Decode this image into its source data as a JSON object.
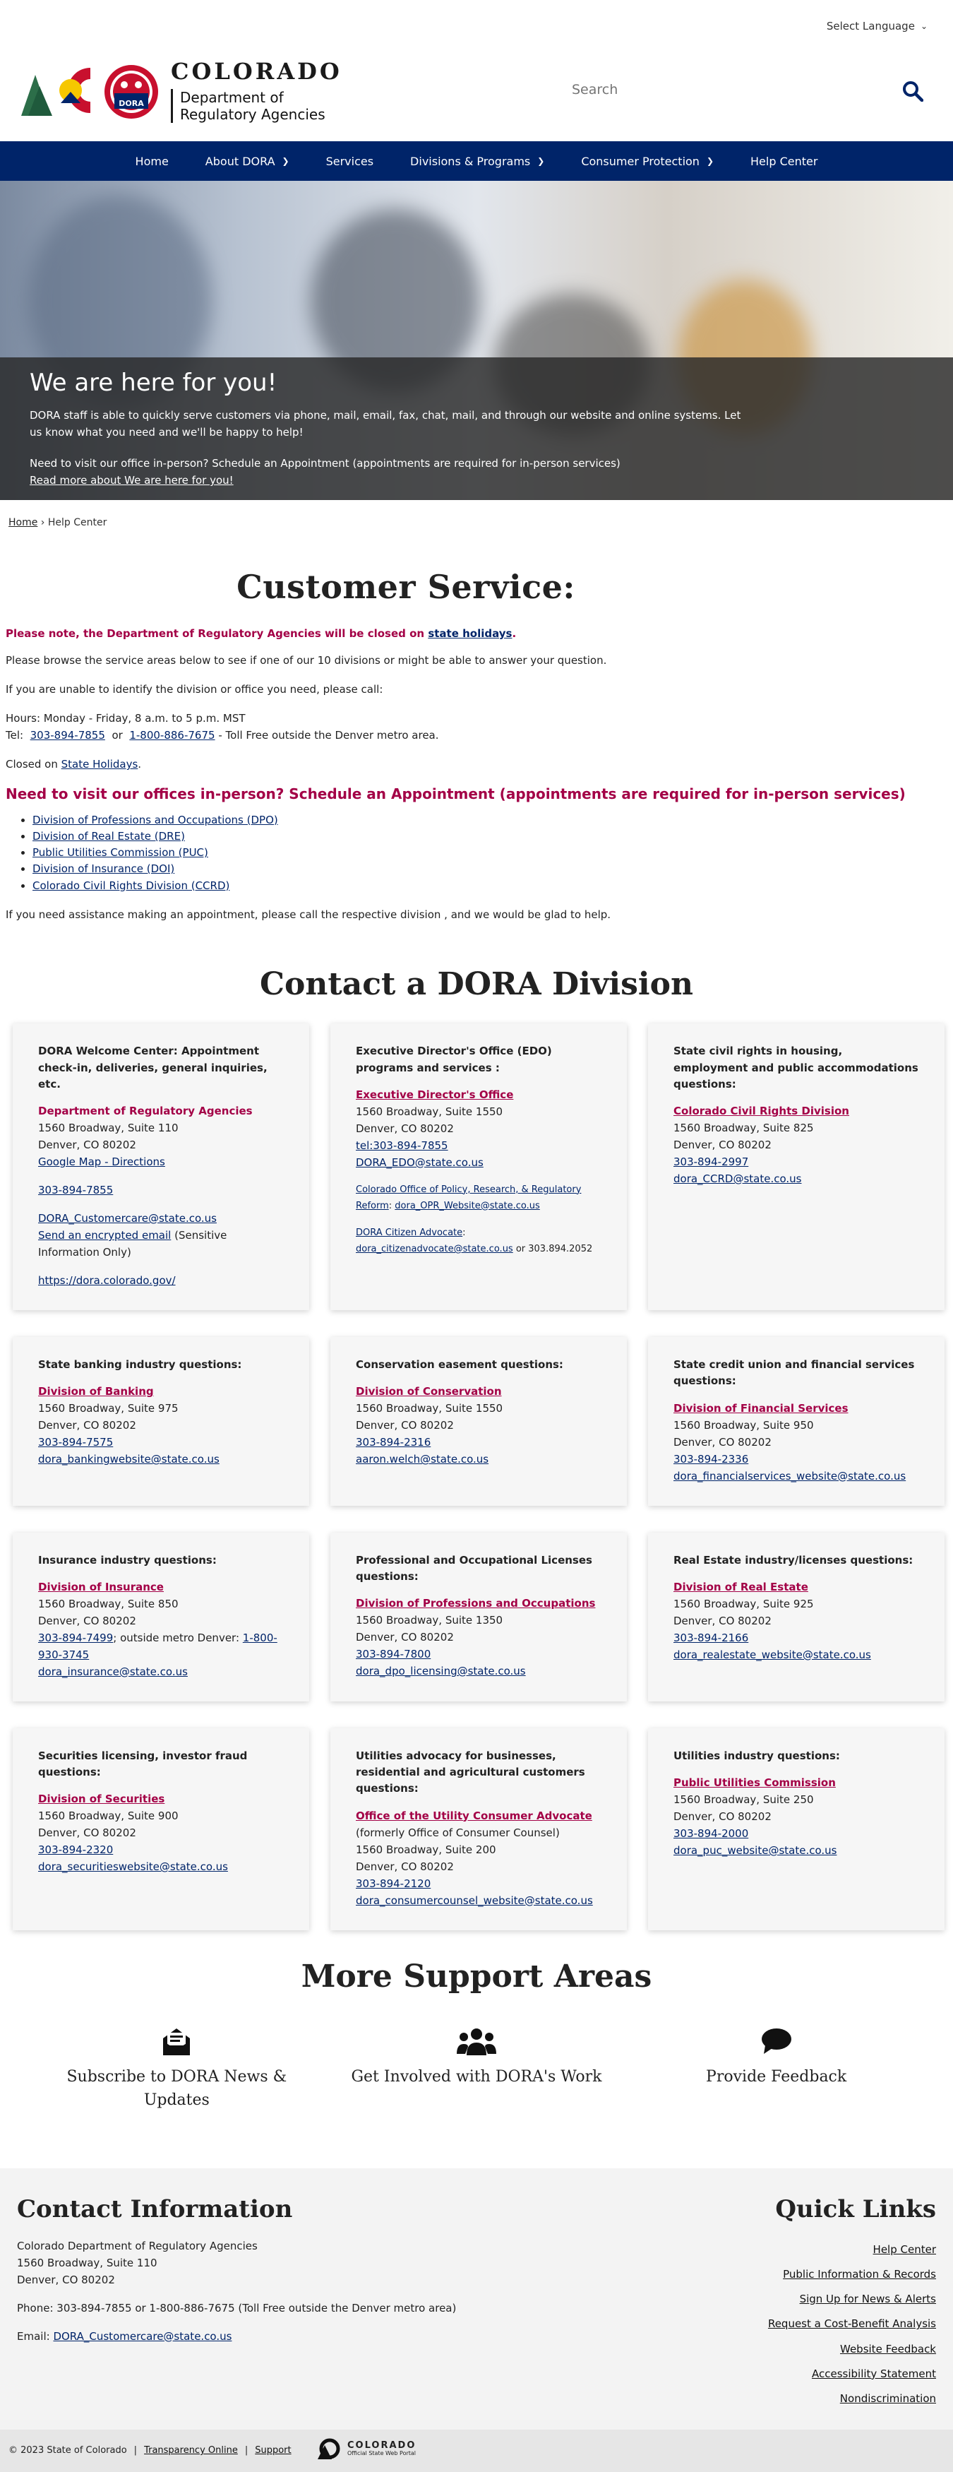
{
  "header": {
    "language_label": "Select Language",
    "logo_state": "COLORADO",
    "logo_agency_line1": "Department of",
    "logo_agency_line2": "Regulatory Agencies",
    "logo_badge": "DORA",
    "search_placeholder": "Search"
  },
  "nav": {
    "items": [
      {
        "label": "Home"
      },
      {
        "label": "About DORA"
      },
      {
        "label": "Services"
      },
      {
        "label": "Divisions & Programs"
      },
      {
        "label": "Consumer Protection"
      },
      {
        "label": "Help Center"
      }
    ]
  },
  "hero": {
    "title": "We are here for you!",
    "text1": "DORA staff is able to quickly serve customers via phone, mail, email, fax, chat, mail, and through our website and online systems. Let us know what you need and we'll be happy to help!",
    "text2": "Need to visit our office in-person? Schedule an Appointment (appointments are required for in-person services)",
    "link": "Read more about We are here for you!"
  },
  "breadcrumb": {
    "home": "Home",
    "current": "Help Center"
  },
  "customer_service": {
    "title": "Customer Service:",
    "notice_text": "Please note, the Department of Regulatory Agencies will be closed on ",
    "notice_link": "state holidays",
    "browse": "Please browse the service areas below to see if one of our 10 divisions or might be able to answer your question.",
    "unable": "If you are unable to identify the division or office you need, please call:",
    "hours": "Hours:  Monday - Friday, 8 a.m. to 5 p.m. MST",
    "tel_label": "Tel:",
    "tel1": "303-894-7855",
    "tel_or": "or",
    "tel2": "1-800-886-7675",
    "tel_suffix": "- Toll Free outside the Denver metro area.",
    "closed_label": "Closed on",
    "closed_link": "State Holidays",
    "visit_heading": "Need to visit our offices in-person? Schedule an Appointment (appointments are required for in-person services)",
    "divisions": [
      "Division of Professions and Occupations (DPO)",
      "Division of Real Estate (DRE)",
      "Public Utilities Commission (PUC)",
      "Division of Insurance (DOI)",
      "Colorado Civil Rights Division (CCRD)"
    ],
    "assist": "If you need assistance making an appointment, please call the respective division , and we would be glad to help."
  },
  "contact_title": "Contact a DORA Division",
  "cards": {
    "welcome": {
      "q": "DORA Welcome Center: Appointment check-in, deliveries, general inquiries, etc.",
      "name": "Department of Regulatory Agencies",
      "addr1": "1560 Broadway, Suite 110",
      "addr2": "Denver, CO  80202",
      "map": "Google Map - Directions",
      "phone": "303-894-7855",
      "email": "DORA_Customercare@state.co.us",
      "encrypted": "Send an encrypted email",
      "encrypted_note": " (Sensitive Information Only)",
      "web": "https://dora.colorado.gov/"
    },
    "edo": {
      "q": "Executive Director's Office (EDO) programs and services :",
      "name": "Executive Director's Office",
      "addr1": "1560 Broadway, Suite 1550",
      "addr2": "Denver, CO 80202",
      "tel": "tel:303-894-7855",
      "email": "DORA_EDO@state.co.us",
      "copr": "Colorado Office of Policy, Research, & Regulatory Reform",
      "copr_sep": ":  ",
      "copr_email": "dora_OPR_Website@state.co.us",
      "advocate": "DORA Citizen Advocate",
      "advocate_sep": ":",
      "advocate_email": "dora_citizenadvocate@state.co.us",
      "advocate_phone": " or 303.894.2052"
    },
    "ccrd": {
      "q": "State civil rights in housing, employment and public accommodations questions:",
      "name": "Colorado Civil Rights Division",
      "addr1": "1560 Broadway, Suite 825",
      "addr2": "Denver, CO  80202",
      "phone": "303-894-2997",
      "email": "dora_CCRD@state.co.us"
    },
    "banking": {
      "q": "State banking industry questions:",
      "name": "Division of Banking",
      "addr1": "1560 Broadway, Suite 975",
      "addr2": "Denver, CO  80202",
      "phone": "303-894-7575",
      "email": "dora_bankingwebsite@state.co.us"
    },
    "conservation": {
      "q": "Conservation easement questions:",
      "name": "Division of Conservation",
      "addr1": "1560 Broadway, Suite 1550",
      "addr2": "Denver, CO  80202",
      "phone": "303-894-2316",
      "email": "aaron.welch@state.co.us"
    },
    "financial": {
      "q": "State credit union and financial services questions:",
      "name": "Division of Financial Services",
      "addr1": "1560 Broadway, Suite 950",
      "addr2": "Denver, CO  80202",
      "phone": "303-894-2336",
      "email": "dora_financialservices_website@state.co.us"
    },
    "insurance": {
      "q": "Insurance industry questions:",
      "name": "Division of Insurance",
      "addr1": "1560 Broadway, Suite 850",
      "addr2": "Denver, CO  80202",
      "phone": "303-894-7499",
      "phone_mid": "; outside metro Denver: ",
      "phone2": "1-800-930-3745",
      "email": "dora_insurance@state.co.us"
    },
    "dpo": {
      "q": "Professional and Occupational Licenses questions:",
      "name": "Division of Professions and Occupations",
      "addr1": "1560 Broadway, Suite 1350",
      "addr2": "Denver, CO  80202",
      "phone": "303-894-7800",
      "email": "dora_dpo_licensing@state.co.us"
    },
    "realestate": {
      "q": "Real Estate industry/licenses questions:",
      "name": "Division of Real Estate",
      "addr1": "1560 Broadway, Suite 925",
      "addr2": "Denver, CO  80202",
      "phone": "303-894-2166",
      "email": "dora_realestate_website@state.co.us"
    },
    "securities": {
      "q": "Securities licensing, investor fraud questions:",
      "name": "Division of Securities",
      "addr1": "1560 Broadway, Suite 900",
      "addr2": "Denver, CO  80202",
      "phone": "303-894-2320",
      "email": "dora_securitieswebsite@state.co.us"
    },
    "ucc": {
      "q": "Utilities advocacy for businesses, residential and agricultural customers questions:",
      "name": "Office of the Utility Consumer Advocate",
      "note": "(formerly Office of Consumer Counsel)",
      "addr1": "1560 Broadway, Suite 200",
      "addr2": "Denver, CO  80202",
      "phone": "303-894-2120",
      "email": "dora_consumercounsel_website@state.co.us"
    },
    "puc": {
      "q": "Utilities industry questions:",
      "name": "Public Utilities Commission",
      "addr1": "1560 Broadway, Suite 250",
      "addr2": "Denver, CO  80202",
      "phone": "303-894-2000",
      "email": "dora_puc_website@state.co.us"
    }
  },
  "support": {
    "title": "More Support Areas",
    "items": [
      {
        "label": "Subscribe to DORA News & Updates",
        "icon": "envelope-icon"
      },
      {
        "label": "Get Involved with DORA's Work",
        "icon": "people-icon"
      },
      {
        "label": "Provide Feedback",
        "icon": "chat-icon"
      }
    ]
  },
  "footer": {
    "contact_title": "Contact Information",
    "org": "Colorado Department of Regulatory Agencies",
    "addr1": "1560 Broadway, Suite 110",
    "addr2": "Denver, CO 80202",
    "phone": "Phone: 303-894-7855 or 1-800-886-7675 (Toll Free outside the Denver metro area)",
    "email_label": "Email: ",
    "email": "DORA_Customercare@state.co.us",
    "quick_title": "Quick Links",
    "links": [
      "Help Center",
      "Public Information & Records",
      "Sign Up for News & Alerts",
      "Request a Cost-Benefit Analysis",
      "Website Feedback",
      "Accessibility Statement",
      "Nondiscrimination"
    ]
  },
  "bottom": {
    "copyright": "© 2023 State of Colorado",
    "sep1": "|",
    "transparency": "Transparency Online",
    "sep2": "|",
    "support": "Support",
    "portal_name": "COLORADO",
    "portal_sub": "Official State Web Portal"
  },
  "colors": {
    "navy": "#002469",
    "crimson": "#a30046",
    "footer_bg": "#f3f3f3"
  }
}
